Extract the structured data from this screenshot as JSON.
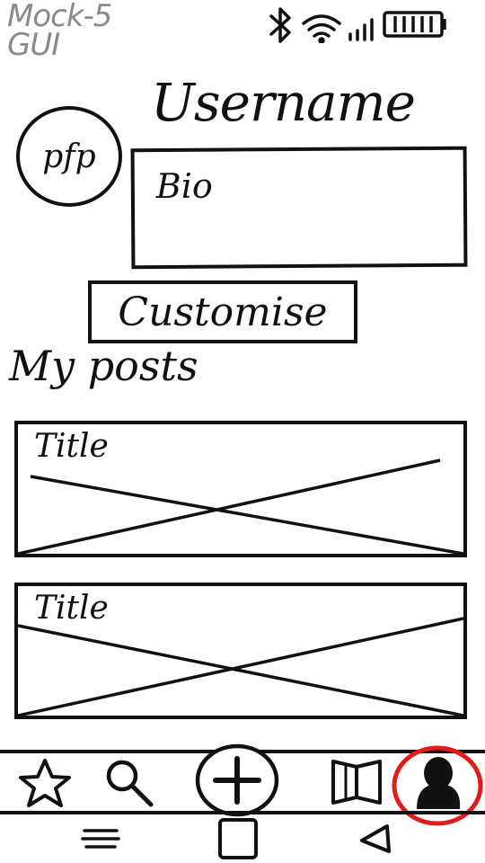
{
  "mock_label": {
    "line1": "Mock-5",
    "line2": "GUI"
  },
  "status_bar": {
    "icons": [
      "bluetooth-icon",
      "wifi-icon",
      "signal-icon",
      "battery-icon"
    ]
  },
  "profile": {
    "pfp_label": "pfp",
    "username": "Username",
    "bio_label": "Bio",
    "customise_label": "Customise"
  },
  "posts": {
    "section_title": "My posts",
    "items": [
      {
        "title": "Title"
      },
      {
        "title": "Title"
      }
    ]
  },
  "bottom_nav": {
    "items": [
      "star-icon",
      "search-icon",
      "add-icon",
      "book-icon",
      "profile-icon"
    ],
    "active": "profile-icon",
    "highlight_color": "#e11b1b"
  },
  "system_nav": {
    "items": [
      "menu-icon",
      "home-icon",
      "back-icon"
    ]
  }
}
